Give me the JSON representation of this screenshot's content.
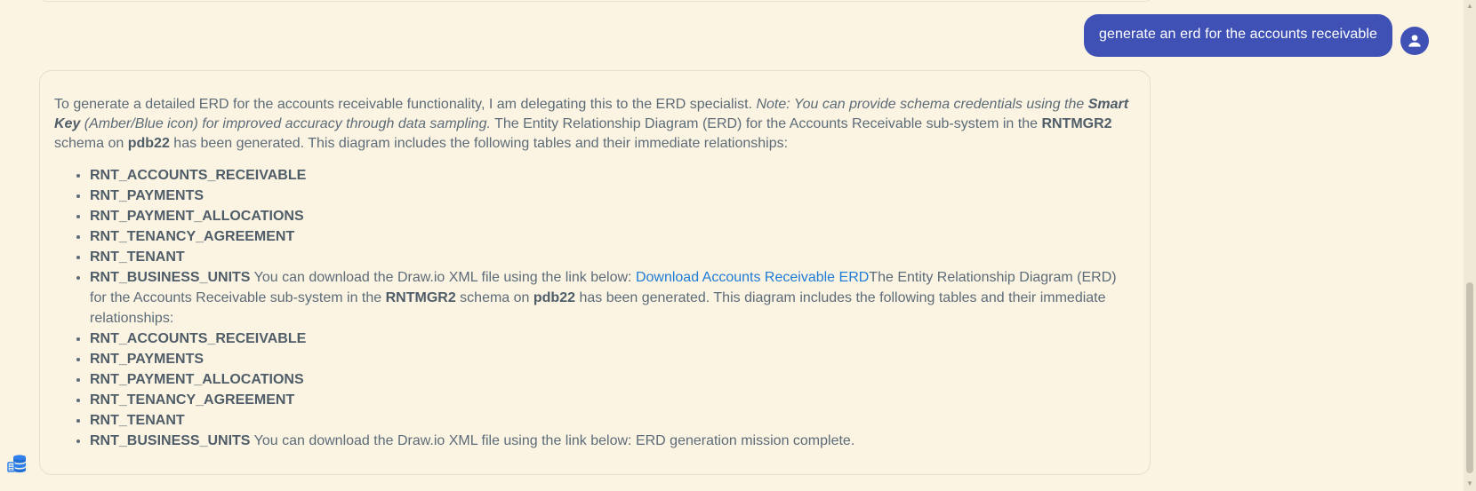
{
  "user_message": {
    "text": "generate an erd for the accounts receivable"
  },
  "assistant_message": {
    "intro_plain": "To generate a detailed ERD for the accounts receivable functionality, I am delegating this to the ERD specialist. ",
    "note_part1": "Note: You can provide schema credentials using the ",
    "note_bold": "Smart Key",
    "note_part2": " (Amber/Blue icon) for improved accuracy through data sampling.",
    "summary_part1": " The Entity Relationship Diagram (ERD) for the Accounts Receivable sub-system in the ",
    "schema": "RNTMGR2",
    "summary_part2": " schema on ",
    "database": "pdb22",
    "summary_part3": " has been generated. This diagram includes the following tables and their immediate relationships:",
    "tables_1": [
      "RNT_ACCOUNTS_RECEIVABLE",
      "RNT_PAYMENTS",
      "RNT_PAYMENT_ALLOCATIONS",
      "RNT_TENANCY_AGREEMENT",
      "RNT_TENANT"
    ],
    "last_item_1": {
      "table": "RNT_BUSINESS_UNITS",
      "text_part1": " You can download the Draw.io XML file using the link below: ",
      "link_text": "Download Accounts Receivable ERD",
      "text_part2": "The Entity Relationship Diagram (ERD) for the Accounts Receivable sub-system in the ",
      "schema": "RNTMGR2",
      "text_part3": " schema on ",
      "database": "pdb22",
      "text_part4": " has been generated. This diagram includes the following tables and their immediate relationships:"
    },
    "tables_2": [
      "RNT_ACCOUNTS_RECEIVABLE",
      "RNT_PAYMENTS",
      "RNT_PAYMENT_ALLOCATIONS",
      "RNT_TENANCY_AGREEMENT",
      "RNT_TENANT"
    ],
    "last_item_2": {
      "table": "RNT_BUSINESS_UNITS",
      "text": " You can download the Draw.io XML file using the link below: ERD generation mission complete."
    }
  },
  "icons": {
    "avatar": "person-icon",
    "database": "database-stack-icon"
  },
  "colors": {
    "background": "#fcf4e2",
    "user_bubble": "#3f51b5",
    "text": "#5c6b78",
    "link": "#1e7bd6"
  }
}
